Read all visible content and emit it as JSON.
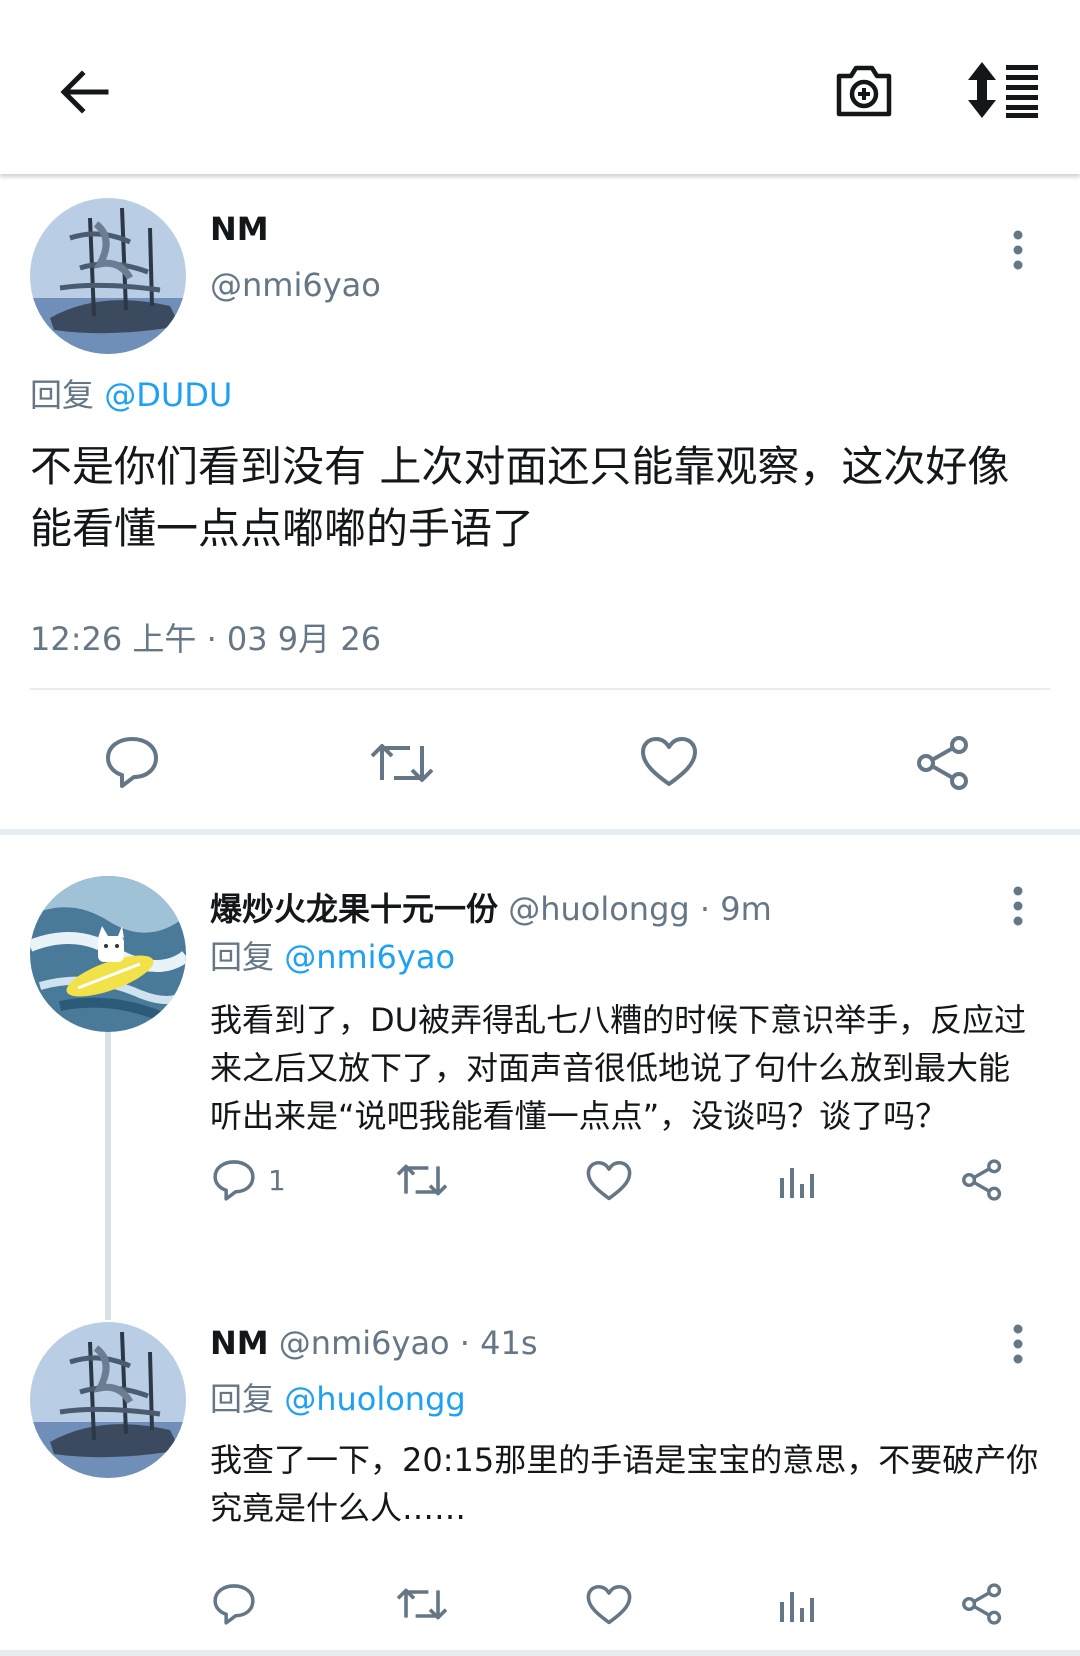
{
  "header": {
    "back_icon": "arrow-left-icon",
    "camera_icon": "camera-plus-icon",
    "sort_icon": "sort-list-icon"
  },
  "main_tweet": {
    "name": "NM",
    "handle": "@nmi6yao",
    "reply_prefix": "回复",
    "reply_to": "@DUDU",
    "text": "不是你们看到没有  上次对面还只能靠观察，这次好像能看懂一点点嘟嘟的手语了",
    "timestamp": "12:26 上午 · 03 9月 26"
  },
  "replies": [
    {
      "name": "爆炒火龙果十元一份",
      "handle": "@huolongg",
      "time": "· 9m",
      "reply_prefix": "回复",
      "reply_to": "@nmi6yao",
      "text": "我看到了，DU被弄得乱七八糟的时候下意识举手，反应过来之后又放下了，对面声音很低地说了句什么放到最大能听出来是“说吧我能看懂一点点”，没谈吗？谈了吗？",
      "reply_count": "1"
    },
    {
      "name": "NM",
      "handle": "@nmi6yao",
      "time": "· 41s",
      "reply_prefix": "回复",
      "reply_to": "@huolongg",
      "text": "我查了一下，20:15那里的手语是宝宝的意思，不要破产你究竟是什么人……",
      "reply_count": ""
    }
  ],
  "colors": {
    "accent": "#1da1f2",
    "secondary_text": "#657786",
    "primary_text": "#14171a",
    "divider": "#e6ecf0"
  }
}
